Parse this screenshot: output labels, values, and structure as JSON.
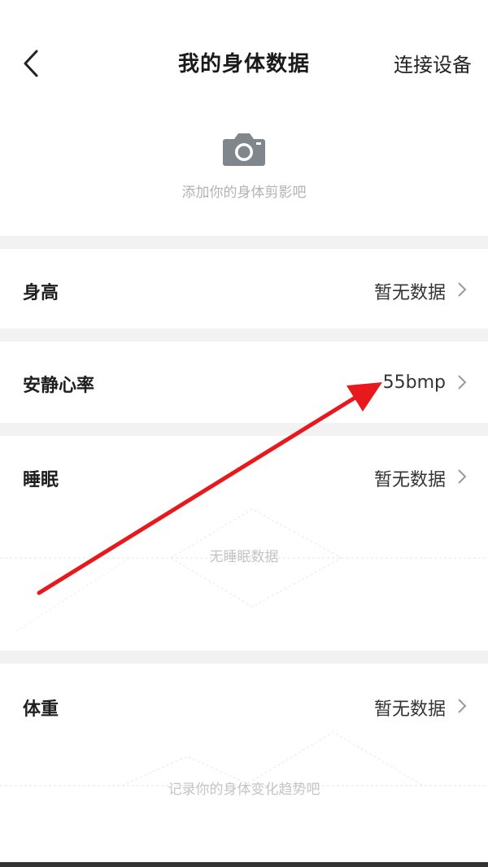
{
  "header": {
    "title": "我的身体数据",
    "connect_label": "连接设备"
  },
  "photo": {
    "hint": "添加你的身体剪影吧"
  },
  "rows": {
    "height": {
      "label": "身高",
      "value": "暂无数据"
    },
    "heart_rate": {
      "label": "安静心率",
      "value": "55bmp"
    },
    "sleep": {
      "label": "睡眠",
      "value": "暂无数据",
      "empty_text": "无睡眠数据"
    },
    "weight": {
      "label": "体重",
      "value": "暂无数据",
      "empty_text": "记录你的身体变化趋势吧"
    }
  },
  "icons": {
    "back": "chevron-left-icon",
    "camera": "camera-icon",
    "chevron": "chevron-right-icon"
  },
  "colors": {
    "annotation_arrow": "#e8191c",
    "section_gap": "#f2f2f2",
    "muted_text": "#b3b3b3"
  }
}
